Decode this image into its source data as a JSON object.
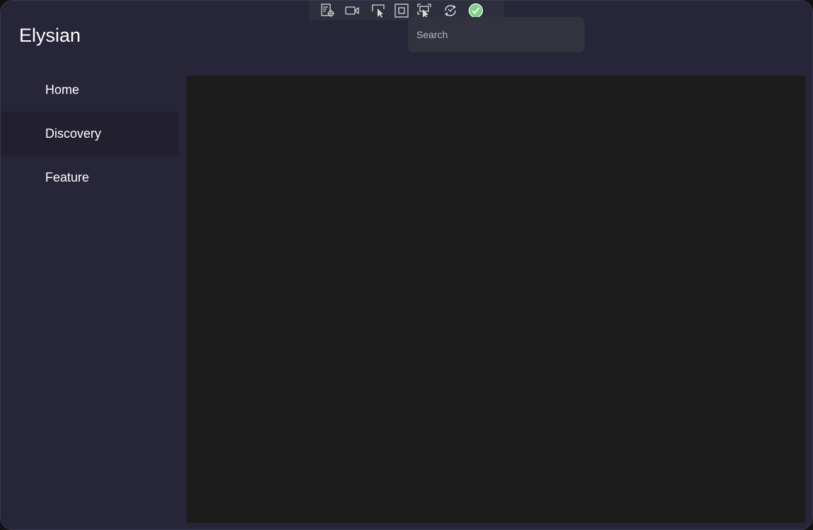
{
  "app": {
    "title": "Elysian"
  },
  "search": {
    "placeholder": "Search",
    "value": ""
  },
  "debug_toolbar": {
    "icons": [
      "live-visual-tree-icon",
      "record-video-icon",
      "select-element-icon",
      "display-layout-adorners-icon",
      "track-focused-element-icon",
      "hot-reload-icon",
      "binding-status-check-icon"
    ]
  },
  "sidebar": {
    "items": [
      {
        "label": "Home",
        "selected": false
      },
      {
        "label": "Discovery",
        "selected": true
      },
      {
        "label": "Feature",
        "selected": false
      }
    ]
  },
  "colors": {
    "window_background": "#272538",
    "content_background": "#1c1c1c",
    "selected_item_background": "#22202f",
    "search_background": "#32333f",
    "toolbar_background": "#2d2f3c",
    "check_badge": "#7ed08a"
  }
}
